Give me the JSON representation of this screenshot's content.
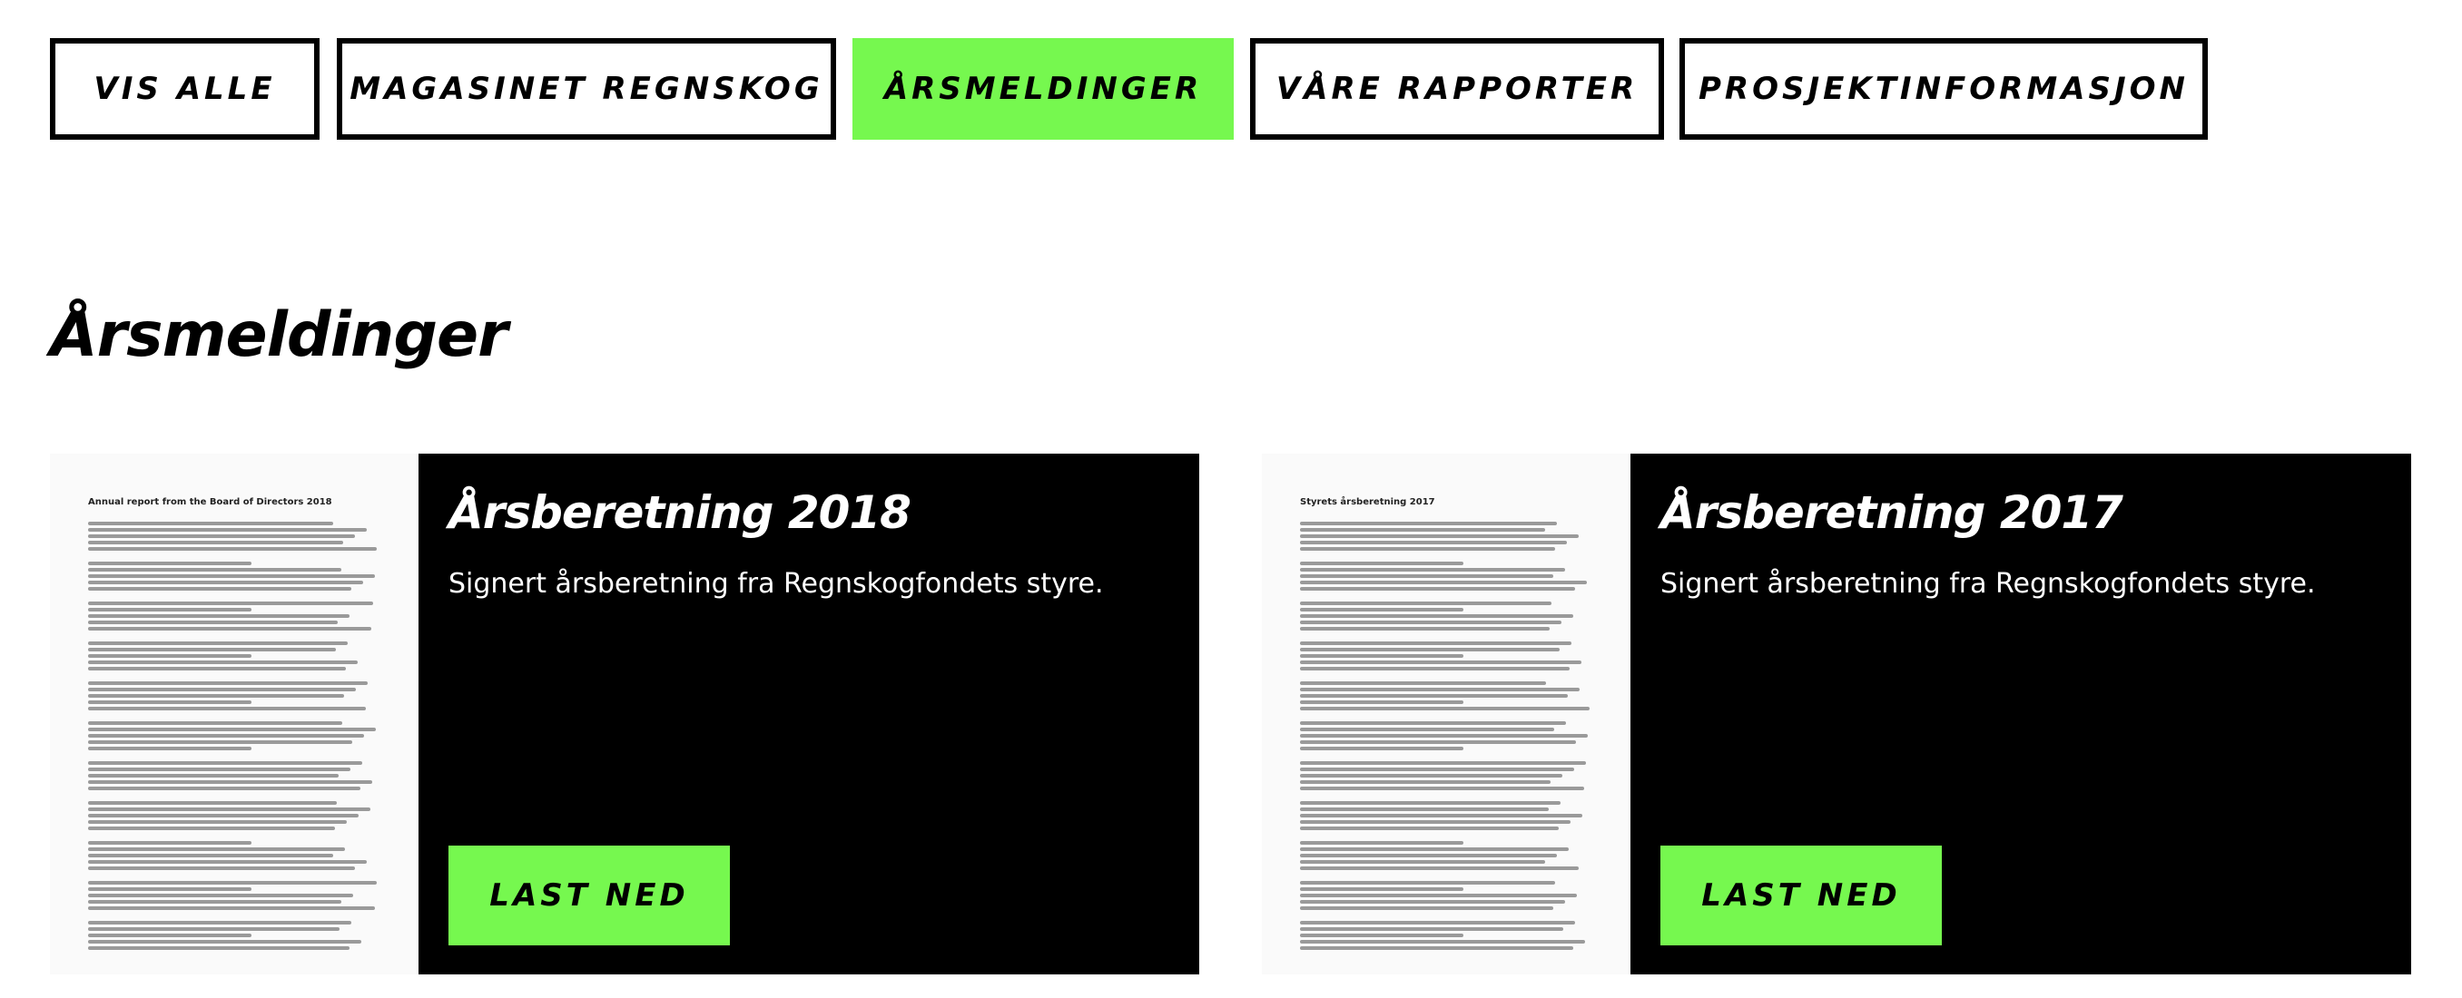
{
  "tabs": [
    {
      "label": "VIS ALLE",
      "active": false
    },
    {
      "label": "MAGASINET REGNSKOG",
      "active": false
    },
    {
      "label": "ÅRSMELDINGER",
      "active": true
    },
    {
      "label": "VÅRE RAPPORTER",
      "active": false
    },
    {
      "label": "PROSJEKTINFORMASJON",
      "active": false
    }
  ],
  "page": {
    "title": "Årsmeldinger"
  },
  "reports": [
    {
      "title": "Årsberetning 2018",
      "description": "Signert årsberetning fra Regnskogfondets styre.",
      "button": "LAST NED",
      "thumb_heading": "Annual report from the Board of Directors 2018"
    },
    {
      "title": "Årsberetning 2017",
      "description": "Signert årsberetning fra Regnskogfondets styre.",
      "button": "LAST NED",
      "thumb_heading": "Styrets årsberetning 2017"
    }
  ],
  "colors": {
    "accent": "#76f84f",
    "panel": "#000000"
  }
}
